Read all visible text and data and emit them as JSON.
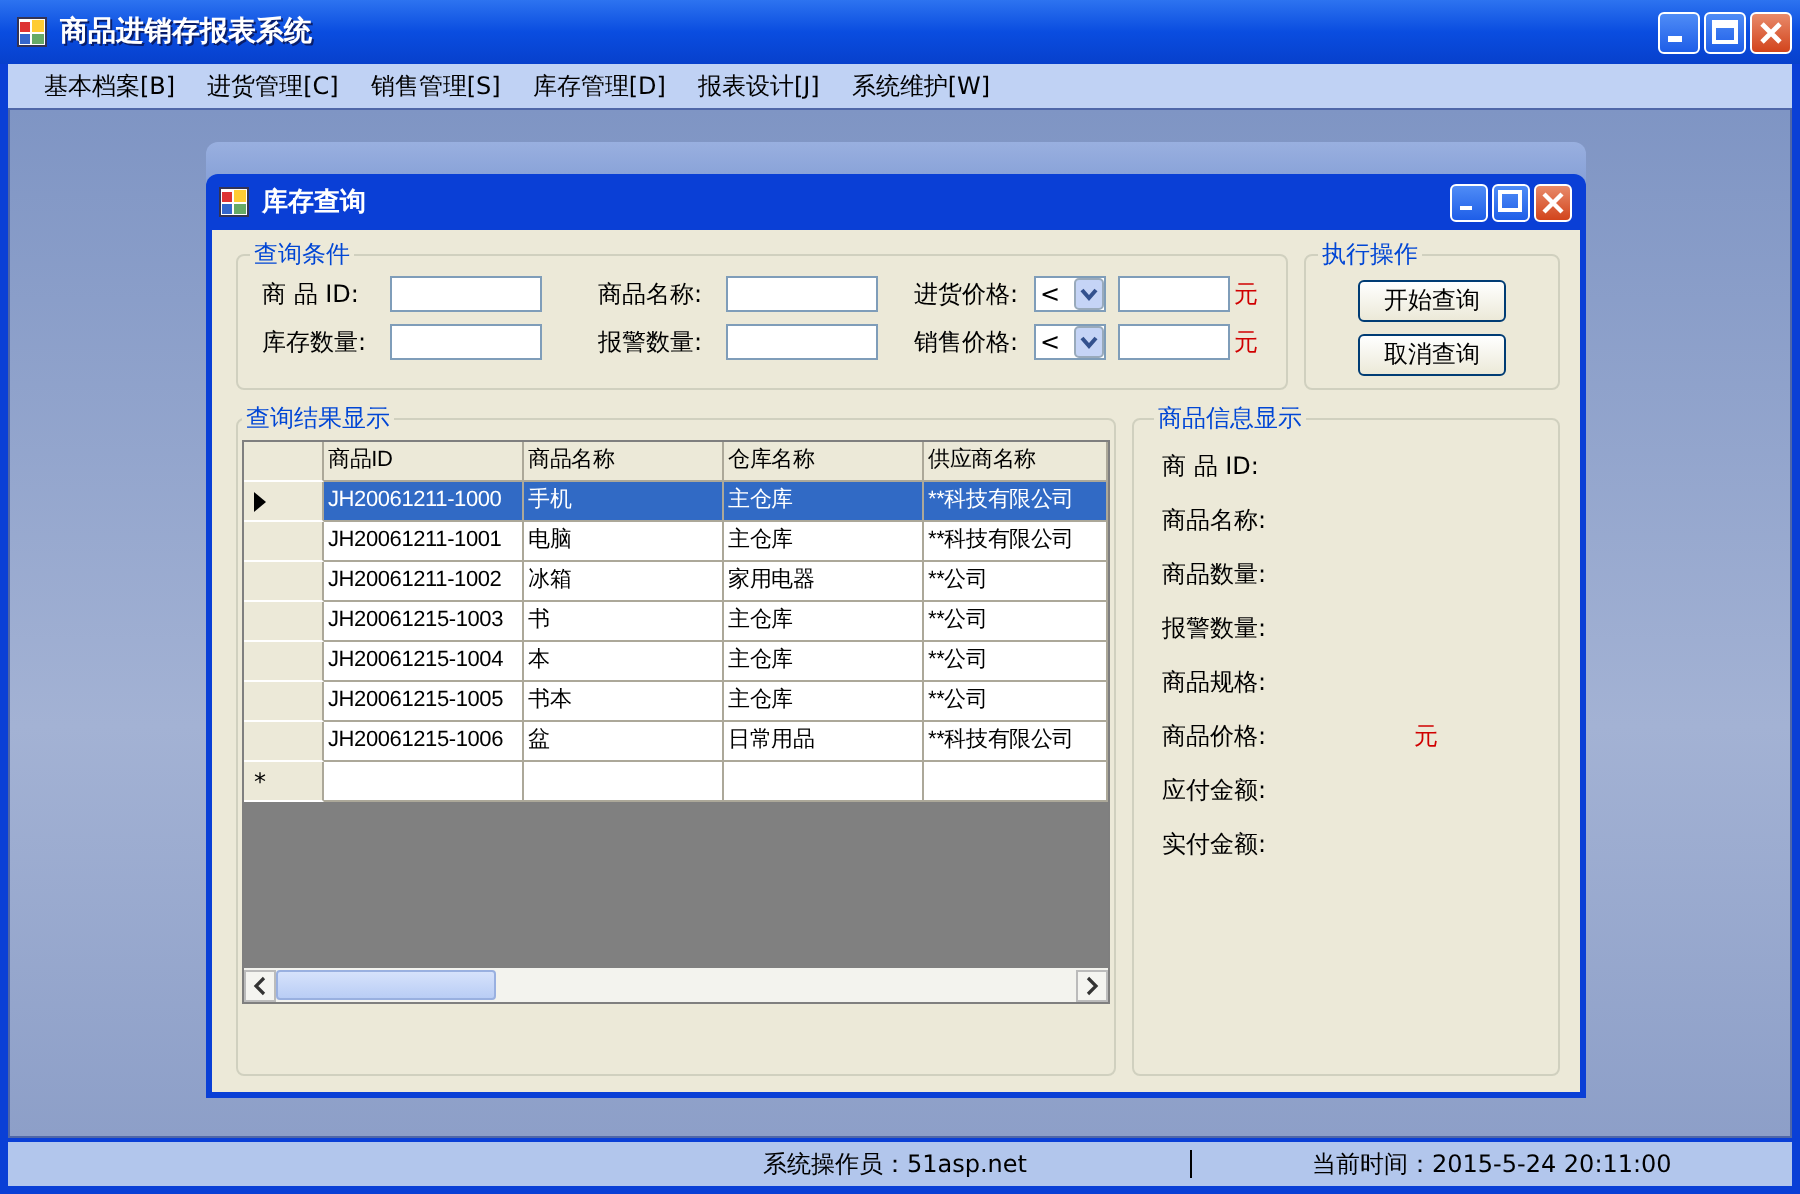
{
  "window": {
    "title": "商品进销存报表系统"
  },
  "menu": [
    {
      "label": "基本档案[B]"
    },
    {
      "label": "进货管理[C]"
    },
    {
      "label": "销售管理[S]"
    },
    {
      "label": "库存管理[D]"
    },
    {
      "label": "报表设计[J]"
    },
    {
      "label": "系统维护[W]"
    }
  ],
  "child_window": {
    "title": "库存查询",
    "query_group": {
      "title": "查询条件",
      "fields": [
        {
          "kind": "text",
          "label": "商 品 ID:"
        },
        {
          "kind": "text",
          "label": "商品名称:"
        },
        {
          "kind": "price",
          "label": "进货价格:",
          "operator": "<",
          "unit": "元"
        },
        {
          "kind": "text",
          "label": "库存数量:"
        },
        {
          "kind": "text",
          "label": "报警数量:"
        },
        {
          "kind": "price",
          "label": "销售价格:",
          "operator": "<",
          "unit": "元"
        }
      ]
    },
    "action_group": {
      "title": "执行操作",
      "buttons": [
        "开始查询",
        "取消查询"
      ]
    },
    "results_group": {
      "title": "查询结果显示",
      "columns": [
        "商品ID",
        "商品名称",
        "仓库名称",
        "供应商名称"
      ],
      "rows": [
        {
          "selected": true,
          "cells": [
            "JH20061211-1000",
            "手机",
            "主仓库",
            "**科技有限公司"
          ]
        },
        {
          "selected": false,
          "cells": [
            "JH20061211-1001",
            "电脑",
            "主仓库",
            "**科技有限公司"
          ]
        },
        {
          "selected": false,
          "cells": [
            "JH20061211-1002",
            "冰箱",
            "家用电器",
            "**公司"
          ]
        },
        {
          "selected": false,
          "cells": [
            "JH20061215-1003",
            "书",
            "主仓库",
            "**公司"
          ]
        },
        {
          "selected": false,
          "cells": [
            "JH20061215-1004",
            "本",
            "主仓库",
            "**公司"
          ]
        },
        {
          "selected": false,
          "cells": [
            "JH20061215-1005",
            "书本",
            "主仓库",
            "**公司"
          ]
        },
        {
          "selected": false,
          "cells": [
            "JH20061215-1006",
            "盆",
            "日常用品",
            "**科技有限公司"
          ]
        }
      ],
      "new_row_marker": "*"
    },
    "info_group": {
      "title": "商品信息显示",
      "fields": [
        {
          "label": "商 品 ID:"
        },
        {
          "label": "商品名称:"
        },
        {
          "label": "商品数量:"
        },
        {
          "label": "报警数量:"
        },
        {
          "label": "商品规格:"
        },
        {
          "label": "商品价格:",
          "unit": "元"
        },
        {
          "label": "应付金额:"
        },
        {
          "label": "实付金额:"
        }
      ]
    }
  },
  "status_bar": {
    "panes": [
      "系统操作员：51asp.net",
      "当前时间：2015-5-24 20:11:00"
    ]
  }
}
